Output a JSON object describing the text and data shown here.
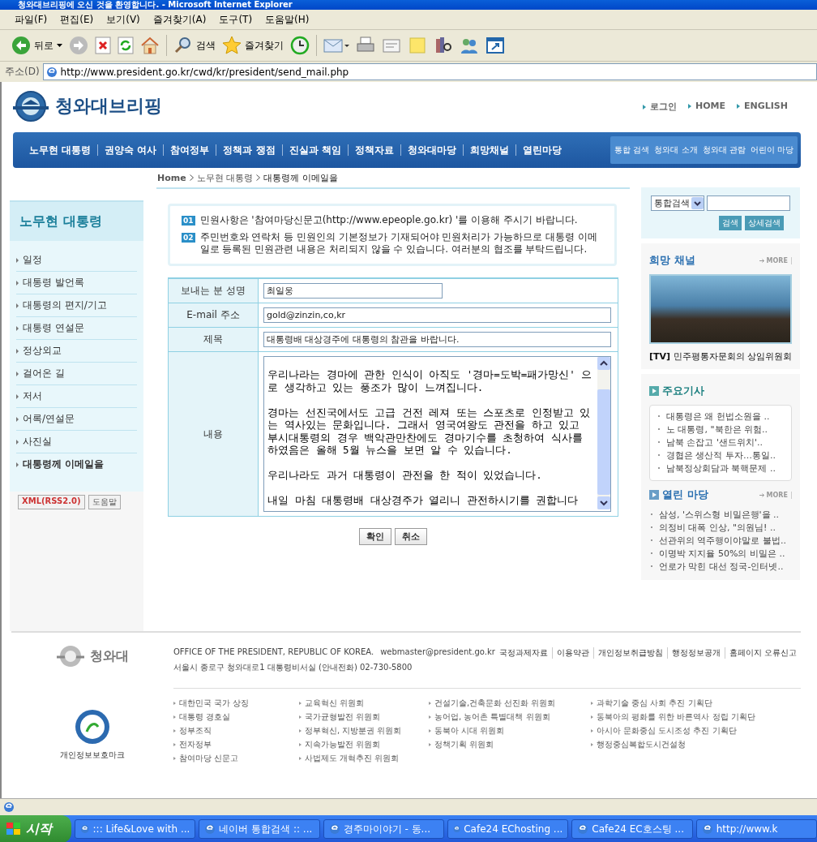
{
  "window": {
    "title": "청와대브리핑에 오신 것을 환영합니다. - Microsoft Internet Explorer"
  },
  "menu_bar": [
    "파일(F)",
    "편집(E)",
    "보기(V)",
    "즐겨찾기(A)",
    "도구(T)",
    "도움말(H)"
  ],
  "toolbar": {
    "back": "뒤로",
    "search": "검색",
    "favorites": "즐겨찾기"
  },
  "address_bar": {
    "label": "주소(D)",
    "url": "http://www.president.go.kr/cwd/kr/president/send_mail.php"
  },
  "header": {
    "logo_text": "청와대브리핑",
    "top_links": [
      "로그인",
      "HOME",
      "ENGLISH"
    ]
  },
  "nav": {
    "items": [
      "노무현 대통령",
      "권양숙 여사",
      "참여정부",
      "정책과 쟁점",
      "진실과 책임",
      "정책자료",
      "청와대마당",
      "희망채널",
      "열린마당"
    ],
    "utility_links": [
      "통합 검색",
      "청와대 소개",
      "청와대 관람",
      "어린이 마당"
    ]
  },
  "breadcrumb": [
    "Home",
    "노무현 대통령",
    "대통령께 이메일을"
  ],
  "sidebar": {
    "title": "노무현 대통령",
    "items": [
      {
        "label": "일정",
        "selected": false
      },
      {
        "label": "대통령 발언록",
        "selected": false
      },
      {
        "label": "대통령의 편지/기고",
        "selected": false
      },
      {
        "label": "대통령 연설문",
        "selected": false
      },
      {
        "label": "정상외교",
        "selected": false
      },
      {
        "label": "걸어온 길",
        "selected": false
      },
      {
        "label": "저서",
        "selected": false
      },
      {
        "label": "어록/연설문",
        "selected": false
      },
      {
        "label": "사진실",
        "selected": false
      },
      {
        "label": "대통령께 이메일을",
        "selected": true
      }
    ],
    "badges": [
      "XML(RSS2.0)",
      "도움말"
    ]
  },
  "notices": [
    {
      "number": "01",
      "text": "민원사항은 '참여마당신문고(http://www.epeople.go.kr) '를 이용해 주시기 바랍니다."
    },
    {
      "number": "02",
      "text": "주민번호와 연락처 등 민원인의 기본정보가 기재되어야 민원처리가 가능하므로 대통령 이메일로 등록된 민원관련 내용은 처리되지 않을 수 있습니다. 여러분의 협조를 부탁드립니다."
    }
  ],
  "form": {
    "rows": [
      {
        "label": "보내는 분 성명",
        "kind": "short",
        "value": "최일웅"
      },
      {
        "label": "E-mail 주소",
        "kind": "input",
        "value": "gold@zinzin,co,kr"
      },
      {
        "label": "제목",
        "kind": "input",
        "value": "대통령배 대상경주에 대통령의 참관을 바랍니다."
      },
      {
        "label": "내용",
        "kind": "textarea",
        "value": "우리나라는 경마에 관한 인식이 아직도 '경마=도박=패가망신' 으로 생각하고 있는 풍조가 많이 느껴집니다.\n\n경마는 선진국에서도 고급 건전 레져 또는 스포츠로 인정받고 있는 역사있는 문화입니다. 그래서 영국여왕도 관전을 하고 있고 부시대통령의 경우 백악관만찬에도 경마기수를 초청하여 식사를 하였음은 올해 5월 뉴스을 보면 알 수 있습니다.\n\n우리나라도 과거 대통령이 관전을 한 적이 있었습니다.\n\n내일 마침 대통령배 대상경주가 열리니 관전하시기를 권합니다"
      }
    ],
    "buttons": [
      "확인",
      "취소"
    ]
  },
  "right": {
    "search_select": "통합검색",
    "search_buttons": [
      "검색",
      "상세검색"
    ],
    "hope_channel": {
      "title": "희망 채널",
      "more": "MORE",
      "caption": "**[TV]** 민주평통자문회의 상임위원회"
    },
    "major_news": {
      "title": "주요기사",
      "items": [
        "대통령은 왜 헌법소원을 ..",
        "노 대통령, \"북한은 위험..",
        "남북 손잡고 '샌드위치'..",
        "경협은 생산적 투자…통일..",
        "남북정상회담과 북핵문제 .."
      ]
    },
    "open_forum": {
      "title": "열린 마당",
      "more": "MORE",
      "items": [
        "삼성, '스위스형 비밀은행'을 ..",
        "의정비 대폭 인상, \"의원님! ..",
        "선관위의 역주행이야말로 불법..",
        "이명박 지지율 50%의 비밀은 ..",
        "언로가 막힌 대선 정국-인터넷.."
      ]
    }
  },
  "footer": {
    "seal_text": "청와대",
    "office": "OFFICE OF THE PRESIDENT, REPUBLIC OF KOREA.",
    "email": "webmaster@president.go.kr",
    "links": [
      "국정과제자료",
      "이용약관",
      "개인정보취급방침",
      "행정정보공개",
      "홈페이지 오류신고"
    ],
    "address": "서울시 종로구 청와대로1 대통령비서실 (안내전화) 02-730-5800",
    "privacy_label": "개인정보보호마크",
    "columns": [
      [
        "대한민국 국가 상징",
        "대통령 경호실",
        "정부조직",
        "전자정부",
        "참여마당 신문고"
      ],
      [
        "교육혁신 위원회",
        "국가균형발전 위원회",
        "정부혁신, 지방분권 위원회",
        "지속가능발전 위원회",
        "사법제도 개혁추진 위원회"
      ],
      [
        "건설기술,건축문화 선진화 위원회",
        "농어업, 농어촌 특별대책 위원회",
        "동북아 시대 위원회",
        "정책기획 위원회"
      ],
      [
        "과학기술 중심 사회 추진 기획단",
        "동북아의 평화를 위한 바른역사 정립 기획단",
        "아시아 문화중심 도시조성 추진 기획단",
        "행정중심복합도시건설청"
      ]
    ]
  },
  "taskbar": {
    "start": "시작",
    "tasks": [
      "::: Life&Love with ...",
      "네이버 통합검색 :: ...",
      "경주마이야기 - 동...",
      "Cafe24 EChosting ...",
      "Cafe24 EC호스팅 ...",
      "http://www.k"
    ]
  }
}
